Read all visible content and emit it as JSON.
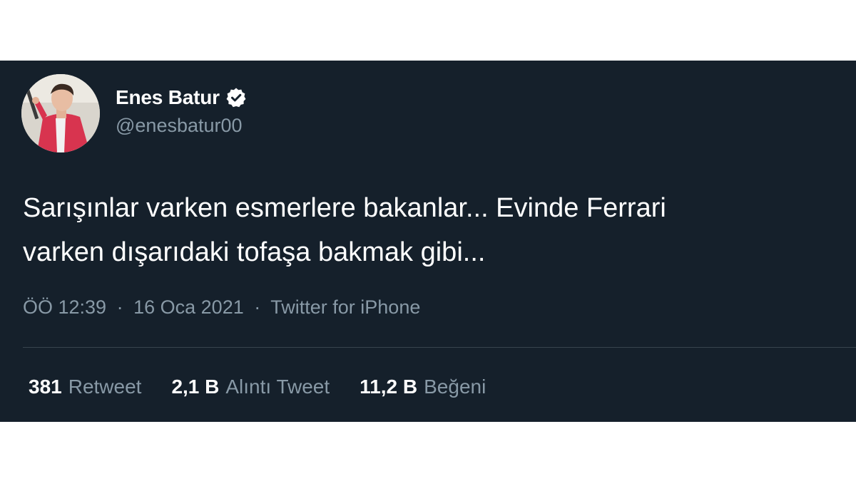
{
  "author": {
    "display_name": "Enes Batur",
    "handle": "@enesbatur00",
    "verified_icon": "verified-badge-icon",
    "avatar_icon": "avatar-photo"
  },
  "tweet": {
    "text_line1": "Sarışınlar varken esmerlere bakanlar... Evinde Ferrari",
    "text_line2": "varken dışarıdaki tofaşa bakmak gibi..."
  },
  "meta": {
    "time": "ÖÖ 12:39",
    "separator": "·",
    "date": "16 Oca 2021",
    "source": "Twitter for iPhone"
  },
  "stats": {
    "retweets": {
      "count": "381",
      "label": "Retweet"
    },
    "quotes": {
      "count": "2,1 B",
      "label": "Alıntı Tweet"
    },
    "likes": {
      "count": "11,2 B",
      "label": "Beğeni"
    }
  },
  "colors": {
    "background": "#15202b",
    "primary_text": "#ffffff",
    "secondary_text": "#8899a6",
    "divider": "#38444d"
  }
}
